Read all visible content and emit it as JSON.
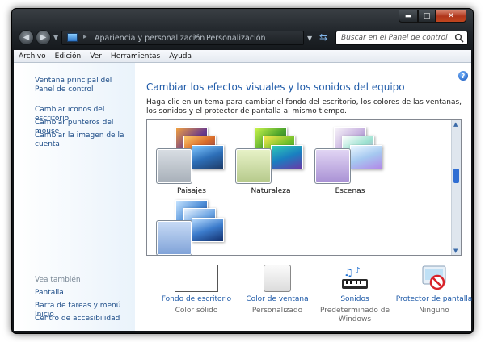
{
  "address": {
    "crumbs": [
      "Apariencia y personalización",
      "Personalización"
    ],
    "search_placeholder": "Buscar en el Panel de control"
  },
  "menu": [
    "Archivo",
    "Edición",
    "Ver",
    "Herramientas",
    "Ayuda"
  ],
  "sidebar": {
    "links": [
      "Ventana principal del Panel de control",
      "Cambiar iconos del escritorio",
      "Cambiar punteros del mouse",
      "Cambiar la imagen de la cuenta"
    ],
    "see_also_heading": "Vea también",
    "see_also": [
      "Pantalla",
      "Barra de tareas y menú Inicio",
      "Centro de accesibilidad"
    ]
  },
  "main": {
    "title": "Cambiar los efectos visuales y los sonidos del equipo",
    "description": "Haga clic en un tema para cambiar el fondo del escritorio, los colores de las ventanas, los sonidos y el protector de pantalla al mismo tiempo.",
    "themes": [
      "Paisajes",
      "Naturaleza",
      "Escenas",
      ""
    ]
  },
  "options": [
    {
      "label": "Fondo de escritorio",
      "value": "Color sólido"
    },
    {
      "label": "Color de ventana",
      "value": "Personalizado"
    },
    {
      "label": "Sonidos",
      "value": "Predeterminado de Windows"
    },
    {
      "label": "Protector de pantalla",
      "value": "Ninguno"
    }
  ]
}
